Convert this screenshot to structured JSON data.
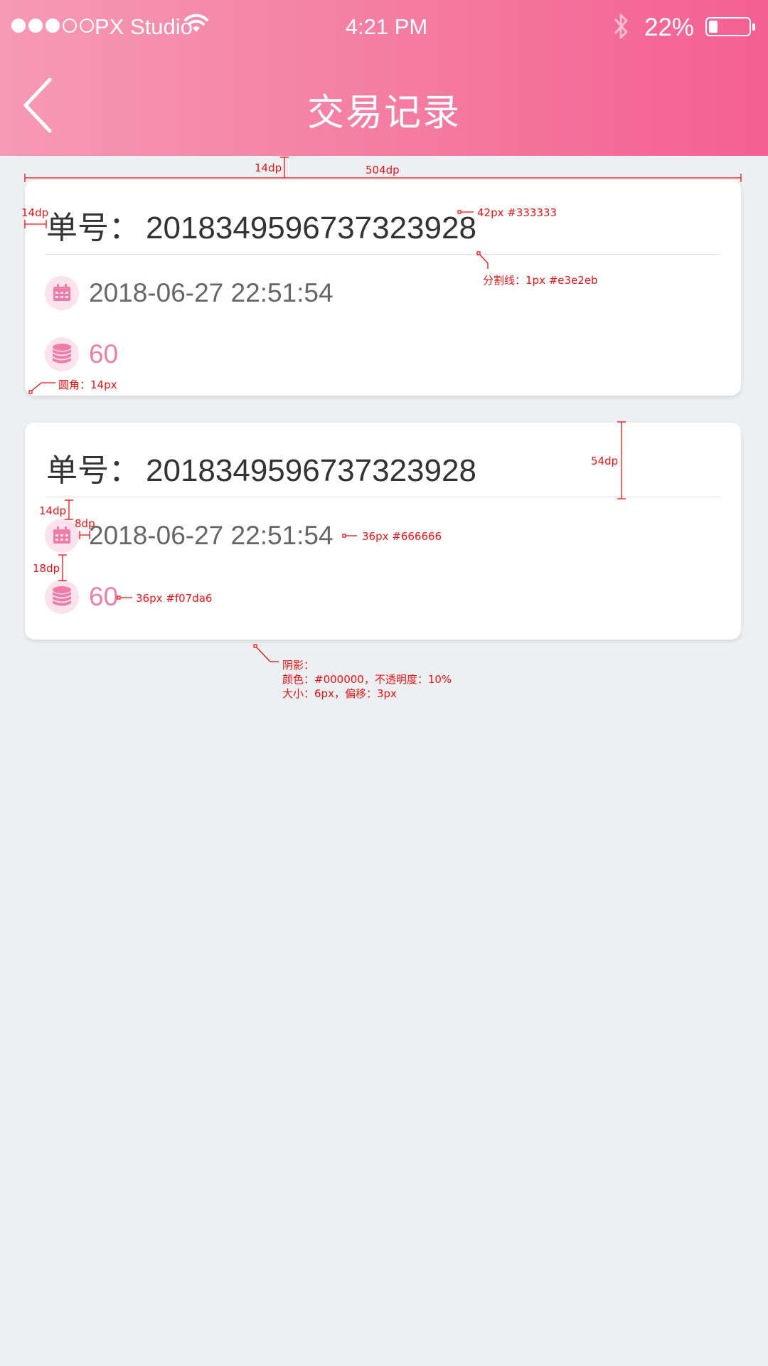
{
  "status_bar": {
    "carrier": "PX Studio",
    "time": "4:21 PM",
    "battery": "22%",
    "battery_level": 0.22,
    "signal_bars": 3,
    "signal_total": 5
  },
  "header": {
    "title": "交易记录",
    "back_icon": "chevron-left-icon",
    "gradient": [
      "#f69ab6",
      "#f45f92"
    ]
  },
  "records": [
    {
      "order_label": "单号：",
      "order_no": "2018349596737323928",
      "date_icon": "calendar-icon",
      "datetime": "2018-06-27 22:51:54",
      "amount_icon": "coins-icon",
      "amount": "60"
    },
    {
      "order_label": "单号：",
      "order_no": "2018349596737323928",
      "date_icon": "calendar-icon",
      "datetime": "2018-06-27 22:51:54",
      "amount_icon": "coins-icon",
      "amount": "60"
    }
  ],
  "annotations": {
    "card_gap": "14dp",
    "card_width": "504dp",
    "padding_left": "14dp",
    "order_font": "42px #333333",
    "divider": "分割线：1px #e3e2eb",
    "radius": "圆角：14px",
    "header_height": "54dp",
    "divider_gap": "14dp",
    "icon_gap": "8dp",
    "date_font": "36px #666666",
    "row_gap": "18dp",
    "amount_font": "36px #f07da6",
    "shadow_title": "阴影：",
    "shadow_color": "颜色：#000000，不透明度：10%",
    "shadow_size": "大小：6px，偏移：3px"
  },
  "colors": {
    "background": "#edf0f2",
    "order_text": "#333333",
    "date_text": "#666666",
    "amount_text": "#f07da6",
    "divider": "#e3e2eb",
    "annotation": "#ee1111"
  }
}
